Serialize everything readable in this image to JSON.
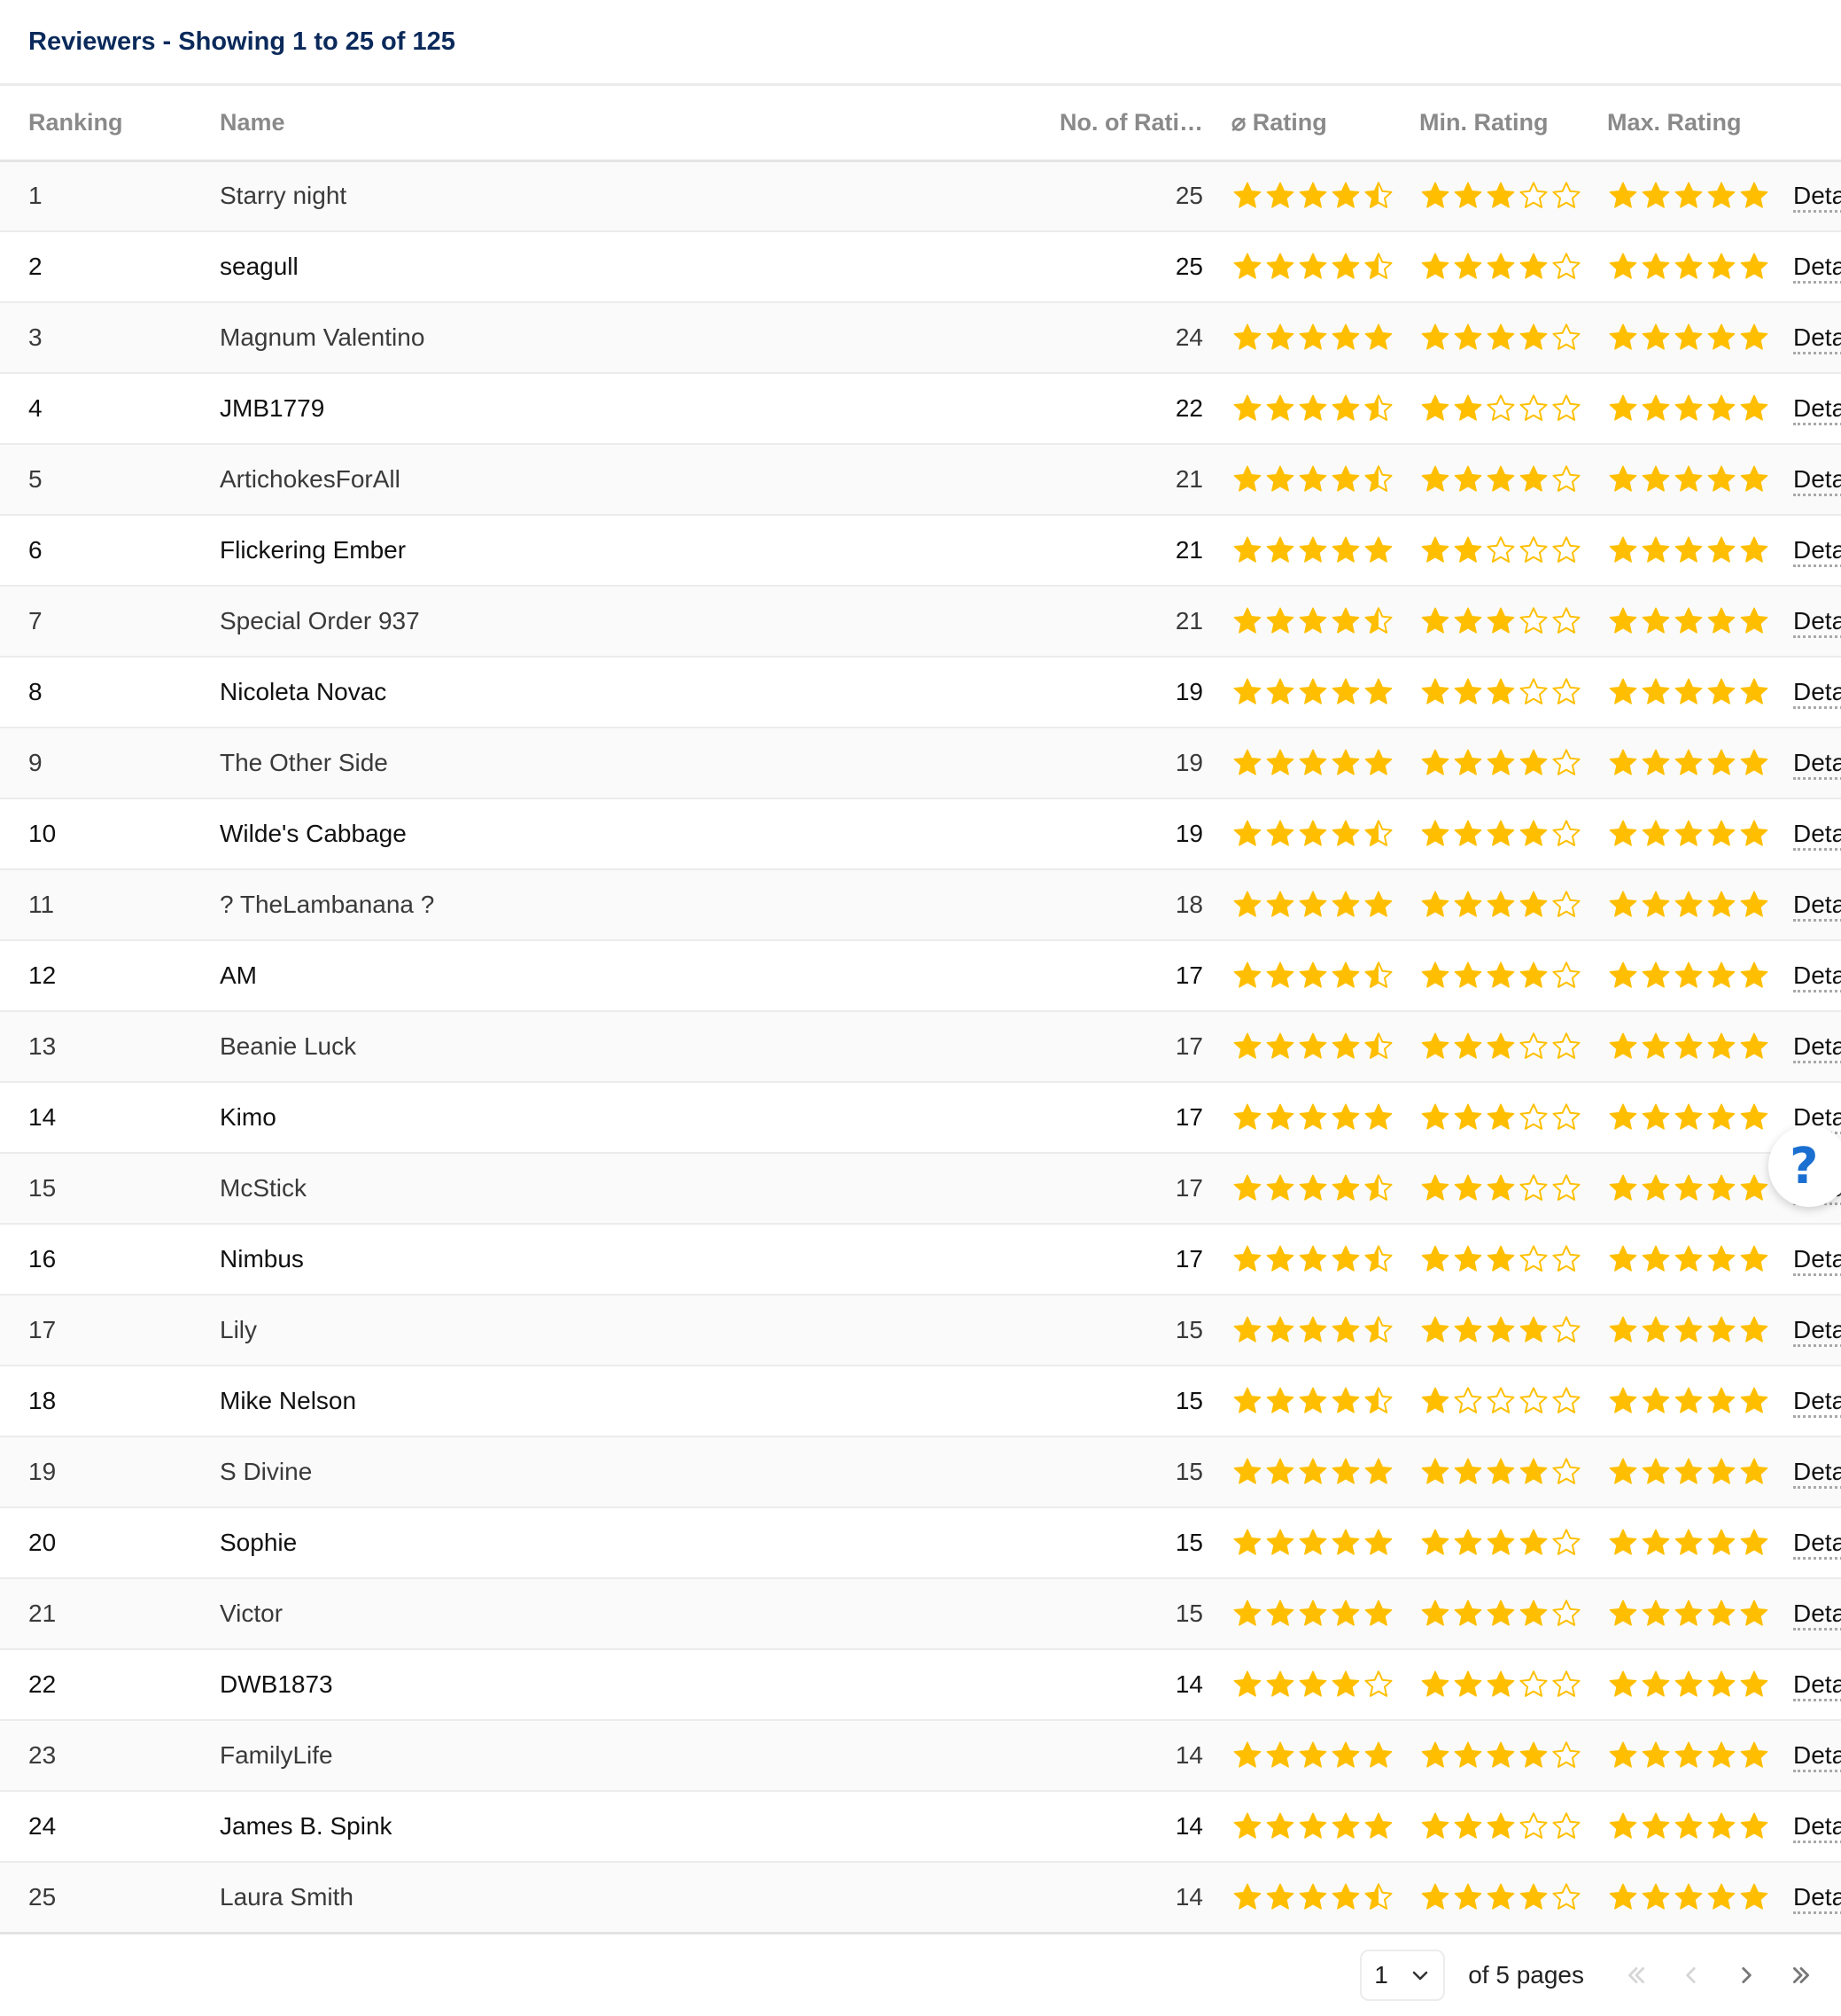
{
  "header": {
    "title": "Reviewers - Showing 1 to 25 of 125"
  },
  "colors": {
    "star": "#ffbf00",
    "title": "#0b2a5b",
    "help": "#1a6fd1"
  },
  "columns": {
    "ranking": "Ranking",
    "name": "Name",
    "count": "No. of Rati…",
    "avg": "⌀ Rating",
    "min": "Min. Rating",
    "max": "Max. Rating"
  },
  "details_label": "Details",
  "rows": [
    {
      "rank": "1",
      "name": "Starry night",
      "count": "25",
      "avg": 4.5,
      "min": 3,
      "max": 5
    },
    {
      "rank": "2",
      "name": "seagull",
      "count": "25",
      "avg": 4.5,
      "min": 4,
      "max": 5
    },
    {
      "rank": "3",
      "name": "Magnum Valentino",
      "count": "24",
      "avg": 5,
      "min": 4,
      "max": 5
    },
    {
      "rank": "4",
      "name": "JMB1779",
      "count": "22",
      "avg": 4.5,
      "min": 2,
      "max": 5
    },
    {
      "rank": "5",
      "name": "ArtichokesForAll",
      "count": "21",
      "avg": 4.5,
      "min": 4,
      "max": 5
    },
    {
      "rank": "6",
      "name": "Flickering Ember",
      "count": "21",
      "avg": 5,
      "min": 2,
      "max": 5
    },
    {
      "rank": "7",
      "name": "Special Order 937",
      "count": "21",
      "avg": 4.5,
      "min": 3,
      "max": 5
    },
    {
      "rank": "8",
      "name": "Nicoleta Novac",
      "count": "19",
      "avg": 5,
      "min": 3,
      "max": 5
    },
    {
      "rank": "9",
      "name": "The Other Side",
      "count": "19",
      "avg": 5,
      "min": 4,
      "max": 5
    },
    {
      "rank": "10",
      "name": "Wilde's Cabbage",
      "count": "19",
      "avg": 4.5,
      "min": 4,
      "max": 5
    },
    {
      "rank": "11",
      "name": "? TheLambanana ?",
      "count": "18",
      "avg": 5,
      "min": 4,
      "max": 5
    },
    {
      "rank": "12",
      "name": "AM",
      "count": "17",
      "avg": 4.5,
      "min": 4,
      "max": 5
    },
    {
      "rank": "13",
      "name": "Beanie Luck",
      "count": "17",
      "avg": 4.5,
      "min": 3,
      "max": 5
    },
    {
      "rank": "14",
      "name": "Kimo",
      "count": "17",
      "avg": 5,
      "min": 3,
      "max": 5
    },
    {
      "rank": "15",
      "name": "McStick",
      "count": "17",
      "avg": 4.5,
      "min": 3,
      "max": 5
    },
    {
      "rank": "16",
      "name": "Nimbus",
      "count": "17",
      "avg": 4.5,
      "min": 3,
      "max": 5
    },
    {
      "rank": "17",
      "name": "Lily",
      "count": "15",
      "avg": 4.5,
      "min": 4,
      "max": 5
    },
    {
      "rank": "18",
      "name": "Mike Nelson",
      "count": "15",
      "avg": 4.5,
      "min": 1,
      "max": 5
    },
    {
      "rank": "19",
      "name": "S Divine",
      "count": "15",
      "avg": 5,
      "min": 4,
      "max": 5
    },
    {
      "rank": "20",
      "name": "Sophie",
      "count": "15",
      "avg": 5,
      "min": 4,
      "max": 5
    },
    {
      "rank": "21",
      "name": "Victor",
      "count": "15",
      "avg": 5,
      "min": 4,
      "max": 5
    },
    {
      "rank": "22",
      "name": "DWB1873",
      "count": "14",
      "avg": 4,
      "min": 3,
      "max": 5
    },
    {
      "rank": "23",
      "name": "FamilyLife",
      "count": "14",
      "avg": 5,
      "min": 4,
      "max": 5
    },
    {
      "rank": "24",
      "name": "James B. Spink",
      "count": "14",
      "avg": 5,
      "min": 3,
      "max": 5
    },
    {
      "rank": "25",
      "name": "Laura Smith",
      "count": "14",
      "avg": 4.5,
      "min": 4,
      "max": 5
    }
  ],
  "pagination": {
    "current_page": "1",
    "of_pages_label": "of 5 pages",
    "icons": [
      "first-page-icon",
      "previous-page-icon",
      "next-page-icon",
      "last-page-icon"
    ]
  },
  "help": {
    "label": "?"
  }
}
